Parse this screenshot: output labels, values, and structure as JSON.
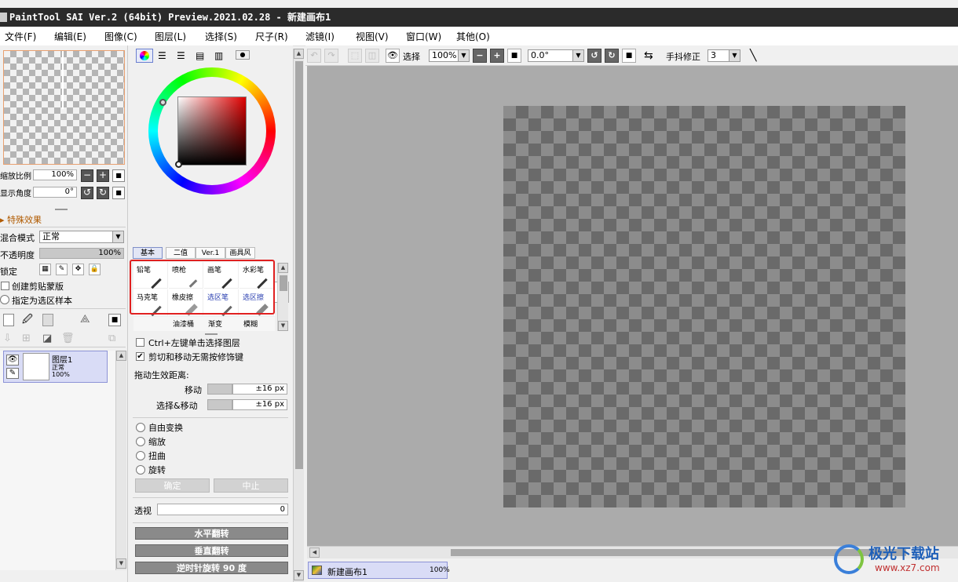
{
  "app": {
    "title": "PaintTool SAI Ver.2 (64bit) Preview.2021.02.28 - 新建画布1"
  },
  "menu": [
    "文件(F)",
    "编辑(E)",
    "图像(C)",
    "图层(L)",
    "选择(S)",
    "尺子(R)",
    "滤镜(I)",
    "视图(V)",
    "窗口(W)",
    "其他(O)"
  ],
  "navigator": {
    "zoom_label": "缩放比例",
    "zoom_value": "100%",
    "angle_label": "显示角度",
    "angle_value": "0°"
  },
  "layer_props": {
    "effects_label": "特殊效果",
    "blend_label": "混合模式",
    "blend_value": "正常",
    "opacity_label": "不透明度",
    "opacity_value": "100%",
    "lock_label": "锁定",
    "clipping_label": "创建剪贴蒙版",
    "selection_source_label": "指定为选区样本"
  },
  "layers": [
    {
      "name": "图层1",
      "mode": "正常",
      "opacity": "100%"
    }
  ],
  "color_tabs": [
    "基本",
    "二值",
    "Ver.1",
    "画具风"
  ],
  "brushes": [
    {
      "label": "铅笔",
      "blue": false
    },
    {
      "label": "喷枪",
      "blue": false
    },
    {
      "label": "画笔",
      "blue": false
    },
    {
      "label": "水彩笔",
      "blue": false
    },
    {
      "label": "马克笔",
      "blue": false
    },
    {
      "label": "橡皮擦",
      "blue": false
    },
    {
      "label": "选区笔",
      "blue": true
    },
    {
      "label": "选区擦",
      "blue": true
    }
  ],
  "brushes_row3": [
    "油漆桶",
    "渐变",
    "模糊"
  ],
  "options": {
    "ctrl_click_label": "Ctrl+左键单击选择图层",
    "cut_move_label": "剪切和移动无需按修饰键",
    "drag_label": "拖动生效距离:",
    "move_label": "移动",
    "move_value": "±16 px",
    "select_move_label": "选择&移动",
    "select_move_value": "±16 px",
    "free_transform": "自由变换",
    "scale": "缩放",
    "distort": "扭曲",
    "rotate": "旋转",
    "ok_label": "确定",
    "cancel_label": "中止",
    "perspective_label": "透视",
    "perspective_value": "0",
    "flip_h": "水平翻转",
    "flip_v": "垂直翻转",
    "rotate_ccw": "逆时针旋转 90 度"
  },
  "toolbar": {
    "select_label": "选择",
    "zoom_value": "100%",
    "angle_value": "0.0°",
    "stabilizer_label": "手抖修正",
    "stabilizer_value": "3"
  },
  "doc_tab": {
    "name": "新建画布1",
    "zoom": "100%"
  },
  "watermark": {
    "text": "极光下载站",
    "url": "www.xz7.com"
  },
  "colors": {
    "highlight_border": "#e02020",
    "primary_color": "#000000",
    "secondary_color": "#ffffff"
  }
}
